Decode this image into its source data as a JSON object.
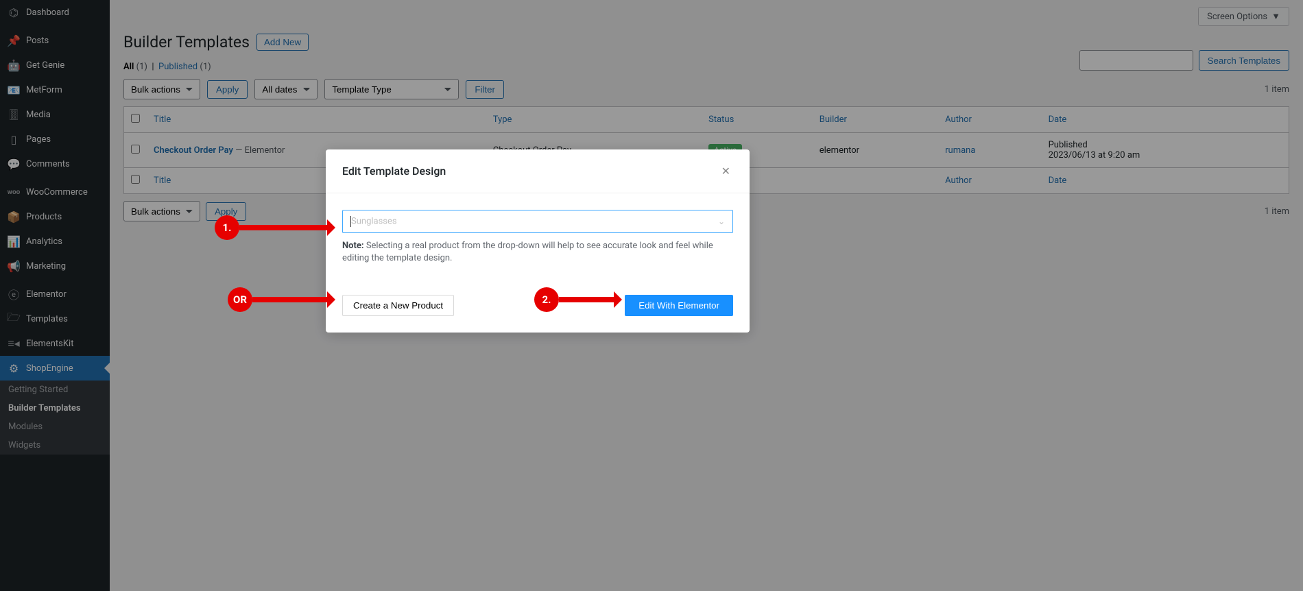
{
  "sidebar": {
    "items": [
      {
        "icon": "⌬",
        "label": "Dashboard"
      },
      {
        "icon": "📌",
        "label": "Posts"
      },
      {
        "icon": "🤖",
        "label": "Get Genie"
      },
      {
        "icon": "📧",
        "label": "MetForm"
      },
      {
        "icon": "🀠",
        "label": "Media"
      },
      {
        "icon": "▯",
        "label": "Pages"
      },
      {
        "icon": "💬",
        "label": "Comments"
      },
      {
        "icon": "woo",
        "label": "WooCommerce"
      },
      {
        "icon": "📦",
        "label": "Products"
      },
      {
        "icon": "📊",
        "label": "Analytics"
      },
      {
        "icon": "📢",
        "label": "Marketing"
      },
      {
        "icon": "ⓔ",
        "label": "Elementor"
      },
      {
        "icon": "🗁",
        "label": "Templates"
      },
      {
        "icon": "≡◂",
        "label": "ElementsKit"
      },
      {
        "icon": "⚙",
        "label": "ShopEngine"
      }
    ],
    "sub": [
      {
        "label": "Getting Started"
      },
      {
        "label": "Builder Templates"
      },
      {
        "label": "Modules"
      },
      {
        "label": "Widgets"
      }
    ]
  },
  "header": {
    "screen_options": "Screen Options",
    "page_title": "Builder Templates",
    "add_new": "Add New"
  },
  "subsub": {
    "all": "All",
    "all_count": "(1)",
    "published": "Published",
    "published_count": "(1)"
  },
  "filters": {
    "bulk_actions": "Bulk actions",
    "apply": "Apply",
    "all_dates": "All dates",
    "template_type": "Template Type",
    "filter": "Filter",
    "search": "Search Templates",
    "item_count": "1 item"
  },
  "table": {
    "cols": {
      "title": "Title",
      "type": "Type",
      "status": "Status",
      "builder": "Builder",
      "author": "Author",
      "date": "Date"
    },
    "row": {
      "title": "Checkout Order Pay",
      "title_suffix": " — Elementor",
      "type": "Checkout Order Pay",
      "status": "Active",
      "builder": "elementor",
      "author": "rumana",
      "date_label": "Published",
      "date_value": "2023/06/13 at 9:20 am"
    }
  },
  "modal": {
    "title": "Edit Template Design",
    "placeholder": "Sunglasses",
    "note_label": "Note:",
    "note_text": " Selecting a real product from the drop-down will help to see accurate look and feel while editing the template design.",
    "create_btn": "Create a New Product",
    "edit_btn": "Edit With Elementor"
  },
  "anno": {
    "one": "1.",
    "two": "2.",
    "or": "OR"
  }
}
